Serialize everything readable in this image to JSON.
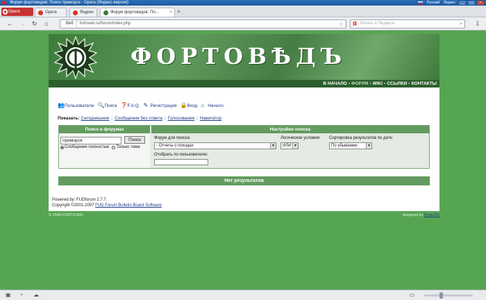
{
  "browser": {
    "window_title": "Форум фортоведов: Поиск приморск - Opera (Яндекс-версия)",
    "tray_language": "Русский",
    "tray_user": "Яндекс",
    "menu_label": "Opera",
    "tabs": [
      {
        "label": "Opera"
      },
      {
        "label": "Яндекс"
      },
      {
        "label": "Форум фортоведов: По..."
      }
    ],
    "new_tab_label": "+",
    "url_badge": "Веб",
    "url": "fortoved.ru/forum/index.php",
    "search_placeholder": "Искать в Яндексе"
  },
  "site": {
    "title": "ФОРТОВѢДЪ",
    "nav": [
      "В НАЧАЛО",
      "ФОРУМ",
      "WIKI",
      "ССЫЛКИ",
      "КОНТАКТЫ"
    ],
    "nav_separator": "•",
    "toolbar": [
      {
        "label": "Пользователи",
        "icon": "users-icon",
        "glyph": "👥"
      },
      {
        "label": "Поиск",
        "icon": "search-icon",
        "glyph": "🔍"
      },
      {
        "label": "F.A.Q.",
        "icon": "help-icon",
        "glyph": "❓"
      },
      {
        "label": "Регистрация",
        "icon": "register-icon",
        "glyph": "✎"
      },
      {
        "label": "Вход",
        "icon": "login-icon",
        "glyph": "🔒"
      },
      {
        "label": "Начало",
        "icon": "home-icon",
        "glyph": "⌂"
      }
    ],
    "show_label": "Показать:",
    "show_links": [
      "Сегодняшние",
      "Сообщения без ответа",
      "Голосования",
      "Навигатор"
    ],
    "show_separator": "::",
    "search": {
      "left_header": "Поиск в форумах",
      "right_header": "Настройки поиска",
      "query_value": "приморск",
      "go_button": "Поиск",
      "radio_full": "Сообщение полностью",
      "radio_subject": "Только тема",
      "forum_label": "Форум для поиска:",
      "forum_value": "- Отчеты о походах",
      "logic_label": "Логическое условие:",
      "logic_value": "ИЛИ",
      "sort_label": "Сортировка результатов по дате:",
      "sort_value": "По убыванию",
      "user_label": "Отобрать по пользователю:",
      "user_value": ""
    },
    "no_results": "Нет результатов",
    "powered_line": "Powered by: FUDforum 2.7.7.",
    "copyright_prefix": "Copyright ©2001-2007",
    "copyright_link": "FUD Forum Bulletin Board Software",
    "footer_left": "© 2008 FORTOVED",
    "footer_right_prefix": "designed by",
    "footer_right_link": "Kosa.RU"
  },
  "colors": {
    "page_background": "#56a552",
    "header_bar": "#639b5f",
    "nav_bar": "#2d5f2d",
    "link": "#1a3a8a"
  }
}
